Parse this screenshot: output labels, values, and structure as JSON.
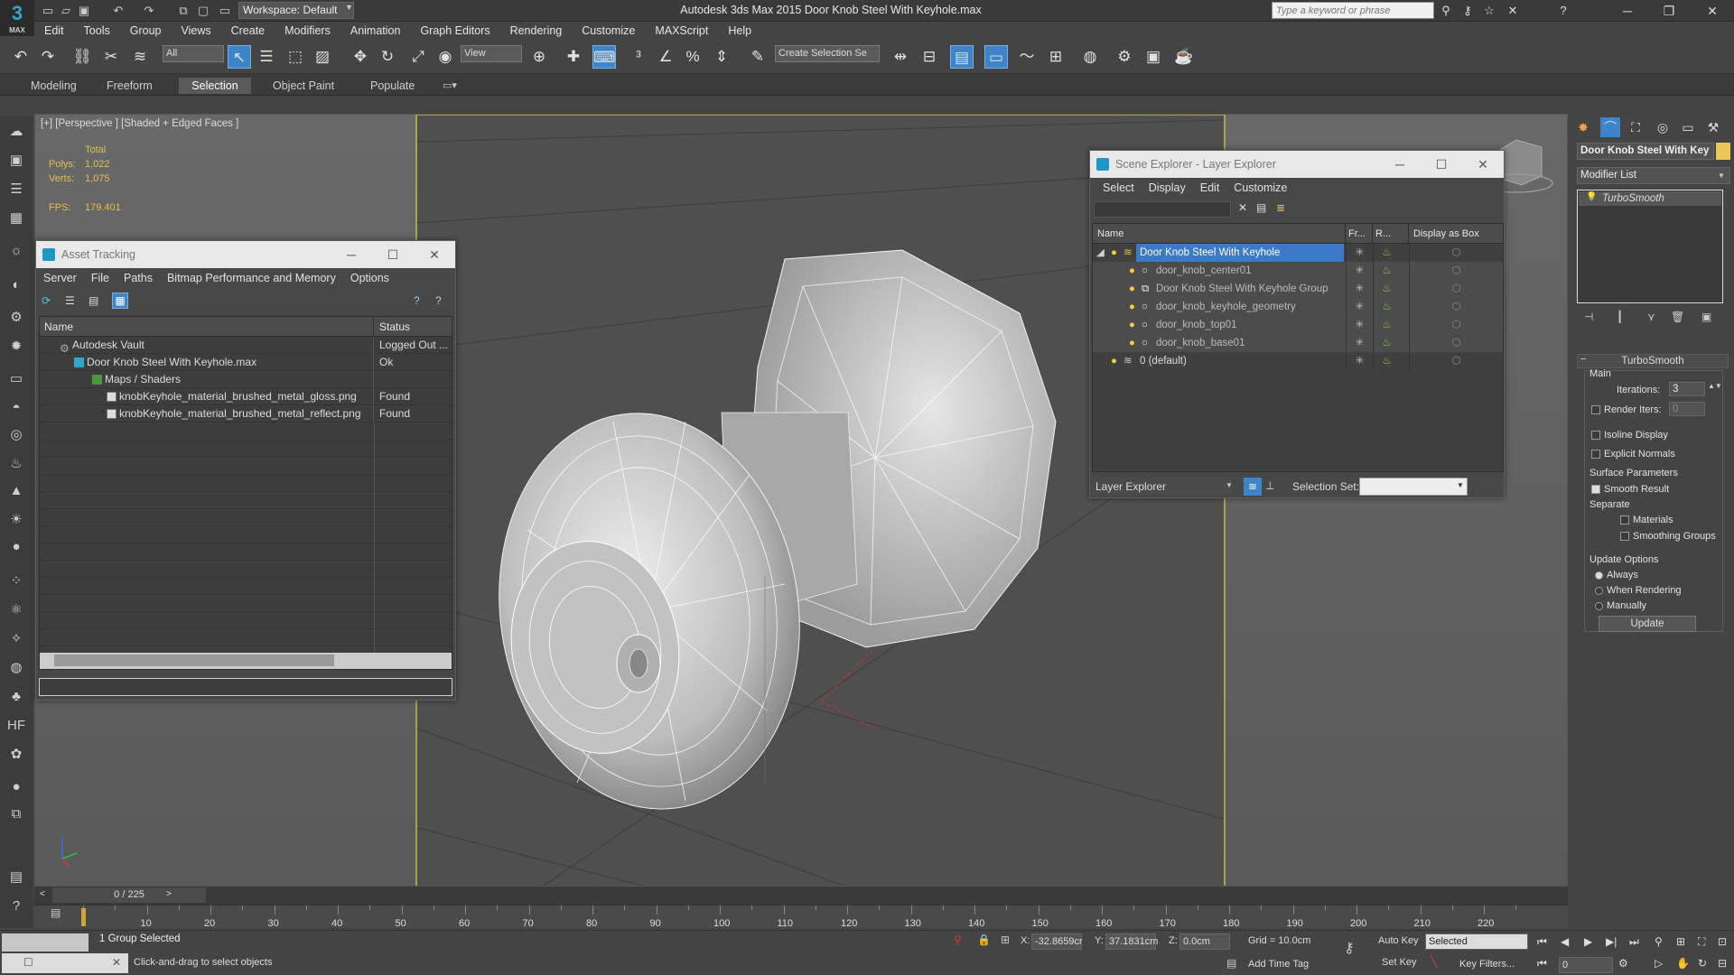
{
  "app": {
    "title": "Autodesk 3ds Max  2015     Door Knob Steel With Keyhole.max",
    "logo": "3",
    "logo_sub": "MAX",
    "workspace": "Workspace: Default",
    "search_placeholder": "Type a keyword or phrase"
  },
  "menu": [
    "Edit",
    "Tools",
    "Group",
    "Views",
    "Create",
    "Modifiers",
    "Animation",
    "Graph Editors",
    "Rendering",
    "Customize",
    "MAXScript",
    "Help"
  ],
  "toolbar": {
    "filter": "All",
    "ref_coord": "View",
    "selection_set": "Create Selection Se"
  },
  "ribbon": {
    "tabs": [
      "Modeling",
      "Freeform",
      "Selection",
      "Object Paint",
      "Populate"
    ],
    "active": "Selection"
  },
  "viewport": {
    "label": "[+] [Perspective ] [Shaded + Edged Faces ]",
    "stats": {
      "total_label": "Total",
      "polys_label": "Polys:",
      "polys": "1,022",
      "verts_label": "Verts:",
      "verts": "1,075",
      "fps_label": "FPS:",
      "fps": "179.401"
    }
  },
  "asset_tracking": {
    "title": "Asset Tracking",
    "menu": [
      "Server",
      "File",
      "Paths",
      "Bitmap Performance and Memory",
      "Options"
    ],
    "columns": [
      "Name",
      "Status"
    ],
    "rows": [
      {
        "name": "Autodesk Vault",
        "status": "Logged Out ..."
      },
      {
        "name": "Door Knob Steel With Keyhole.max",
        "status": "Ok"
      },
      {
        "name": "Maps / Shaders",
        "status": ""
      },
      {
        "name": "knobKeyhole_material_brushed_metal_gloss.png",
        "status": "Found"
      },
      {
        "name": "knobKeyhole_material_brushed_metal_reflect.png",
        "status": "Found"
      }
    ]
  },
  "scene_explorer": {
    "title": "Scene Explorer - Layer Explorer",
    "menu": [
      "Select",
      "Display",
      "Edit",
      "Customize"
    ],
    "columns": [
      "Name",
      "Fr...",
      "R...",
      "Display as Box"
    ],
    "rows": [
      {
        "name": "Door Knob Steel With Keyhole",
        "level": 0,
        "selected": true
      },
      {
        "name": "door_knob_center01",
        "level": 1
      },
      {
        "name": "Door Knob Steel With Keyhole Group",
        "level": 1
      },
      {
        "name": "door_knob_keyhole_geometry",
        "level": 1
      },
      {
        "name": "door_knob_top01",
        "level": 1
      },
      {
        "name": "door_knob_base01",
        "level": 1
      },
      {
        "name": "0 (default)",
        "level": 0
      }
    ],
    "footer_explorer": "Layer Explorer",
    "selection_set_label": "Selection Set:"
  },
  "command_panel": {
    "object_name": "Door Knob Steel With Key",
    "modifier_list": "Modifier List",
    "stack_item": "TurboSmooth",
    "rollout_title": "TurboSmooth",
    "main_group": "Main",
    "iterations_label": "Iterations:",
    "iterations": "3",
    "render_iters_label": "Render Iters:",
    "render_iters": "0",
    "isoline": "Isoline Display",
    "explicit_normals": "Explicit Normals",
    "surface_params": "Surface Parameters",
    "smooth_result": "Smooth Result",
    "separate": "Separate",
    "materials": "Materials",
    "smoothing_groups": "Smoothing Groups",
    "update_options": "Update Options",
    "always": "Always",
    "when_rendering": "When Rendering",
    "manually": "Manually",
    "update_button": "Update"
  },
  "timeline": {
    "frame_counter": "0 / 225",
    "ticks": [
      "10",
      "20",
      "30",
      "40",
      "50",
      "60",
      "70",
      "80",
      "90",
      "100",
      "110",
      "120",
      "130",
      "140",
      "150",
      "160",
      "170",
      "180",
      "190",
      "200",
      "210",
      "220"
    ]
  },
  "status": {
    "selection": "1 Group Selected",
    "prompt": "Click-and-drag to select objects",
    "x_label": "X:",
    "x": "-32.8659cr",
    "y_label": "Y:",
    "y": "37.1831cm",
    "z_label": "Z:",
    "z": "0.0cm",
    "grid": "Grid = 10.0cm",
    "add_time_tag": "Add Time Tag",
    "auto_key": "Auto Key",
    "selected": "Selected",
    "set_key": "Set Key",
    "key_filters": "Key Filters...",
    "frame": "0"
  }
}
